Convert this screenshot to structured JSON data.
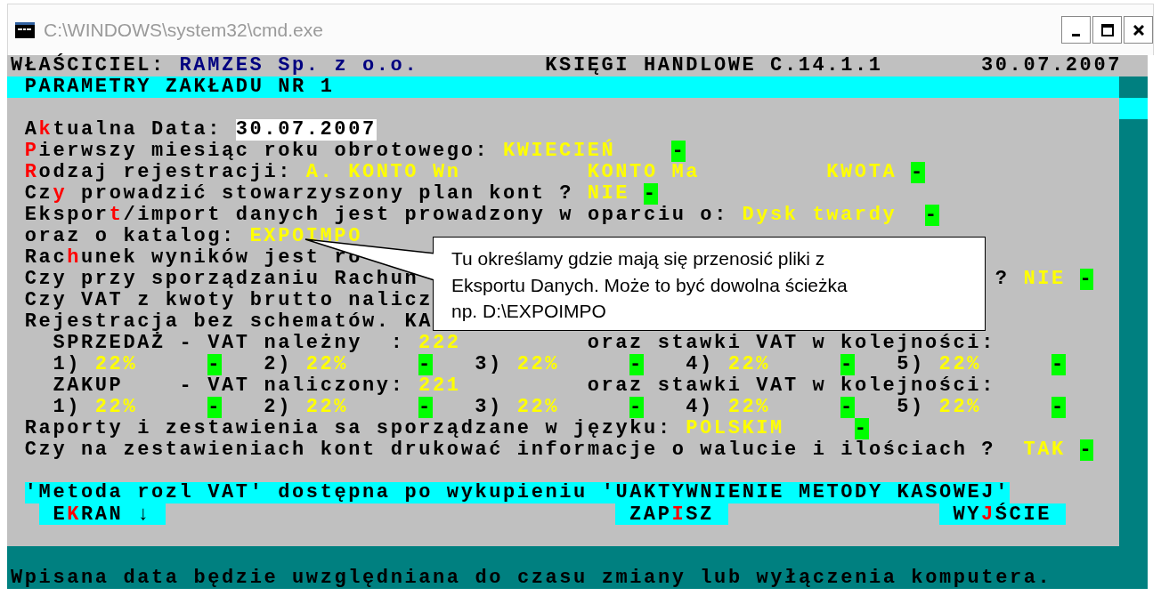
{
  "window": {
    "title": "C:\\WINDOWS\\system32\\cmd.exe"
  },
  "header": [
    {
      "kind": "label",
      "text": "WŁAŚCICIEL:"
    },
    {
      "kind": "owner",
      "text": "RAMZES Sp. z o.o."
    },
    {
      "kind": "label",
      "text": "KSIĘGI HANDLOWE C.14.1.1"
    },
    {
      "kind": "label",
      "text": "30.07.2007"
    }
  ],
  "section_title": "PARAMETRY ZAKŁADU NR 1",
  "form_rows": [
    {
      "segments": [
        {
          "kind": "label",
          "text": "A**k**tualna Data:"
        },
        {
          "kind": "input",
          "text": "30.07.2007"
        }
      ]
    },
    {
      "segments": [
        {
          "kind": "label",
          "text": "**P**ierwszy miesiąc roku obrotowego:"
        },
        {
          "kind": "value",
          "text": "KWIECIEŃ"
        },
        {
          "kind": "marker",
          "text": "-"
        }
      ]
    },
    {
      "segments": [
        {
          "kind": "label",
          "text": "**R**odzaj rejestracji:"
        },
        {
          "kind": "value",
          "text": "A. KONTO Wn"
        },
        {
          "kind": "value",
          "text": "KONTO Ma"
        },
        {
          "kind": "value",
          "text": "KWOTA"
        },
        {
          "kind": "marker",
          "text": "-"
        }
      ]
    },
    {
      "segments": [
        {
          "kind": "label",
          "text": "Cz**y** prowadzić stowarzyszony plan kont ?"
        },
        {
          "kind": "value",
          "text": "NIE"
        },
        {
          "kind": "marker",
          "text": "-"
        }
      ]
    },
    {
      "segments": [
        {
          "kind": "label",
          "text": "Ekspor**t**/import danych jest prowadzony w oparciu o:"
        },
        {
          "kind": "value",
          "text": "Dysk twardy"
        },
        {
          "kind": "marker",
          "text": "-"
        }
      ]
    },
    {
      "segments": [
        {
          "kind": "label",
          "text": "oraz o katalog:"
        },
        {
          "kind": "value",
          "text": "EXPOIMPO"
        }
      ]
    },
    {
      "segments": [
        {
          "kind": "label",
          "text": "Rac**h**unek wyników jest ro"
        }
      ]
    },
    {
      "segments": [
        {
          "kind": "label",
          "text": "Czy przy sporządzaniu Rachun"
        },
        {
          "kind": "label",
          "text": "?"
        },
        {
          "kind": "value",
          "text": "NIE"
        },
        {
          "kind": "marker",
          "text": "-"
        }
      ]
    },
    {
      "segments": [
        {
          "kind": "label",
          "text": "Czy VAT z kwoty brutto nalicz"
        }
      ]
    },
    {
      "segments": [
        {
          "kind": "label",
          "text": "Rejestracja bez schematów. KA"
        }
      ]
    },
    {
      "segments": [
        {
          "kind": "label",
          "text": "SPRZEDAŻ - VAT należny  :"
        },
        {
          "kind": "value",
          "text": "222"
        },
        {
          "kind": "label",
          "text": "oraz stawki VAT w kolejności:"
        }
      ]
    },
    {
      "segments": [
        {
          "kind": "label",
          "text": "1)"
        },
        {
          "kind": "value",
          "text": "22%"
        },
        {
          "kind": "marker",
          "text": "-"
        },
        {
          "kind": "label",
          "text": "2)"
        },
        {
          "kind": "value",
          "text": "22%"
        },
        {
          "kind": "marker",
          "text": "-"
        },
        {
          "kind": "label",
          "text": "3)"
        },
        {
          "kind": "value",
          "text": "22%"
        },
        {
          "kind": "marker",
          "text": "-"
        },
        {
          "kind": "label",
          "text": "4)"
        },
        {
          "kind": "value",
          "text": "22%"
        },
        {
          "kind": "marker",
          "text": "-"
        },
        {
          "kind": "label",
          "text": "5)"
        },
        {
          "kind": "value",
          "text": "22%"
        },
        {
          "kind": "marker",
          "text": "-"
        }
      ]
    },
    {
      "segments": [
        {
          "kind": "label",
          "text": "ZAKUP    - VAT naliczony:"
        },
        {
          "kind": "value",
          "text": "221"
        },
        {
          "kind": "label",
          "text": "oraz stawki VAT w kolejności:"
        }
      ]
    },
    {
      "segments": [
        {
          "kind": "label",
          "text": "1)"
        },
        {
          "kind": "value",
          "text": "22%"
        },
        {
          "kind": "marker",
          "text": "-"
        },
        {
          "kind": "label",
          "text": "2)"
        },
        {
          "kind": "value",
          "text": "22%"
        },
        {
          "kind": "marker",
          "text": "-"
        },
        {
          "kind": "label",
          "text": "3)"
        },
        {
          "kind": "value",
          "text": "22%"
        },
        {
          "kind": "marker",
          "text": "-"
        },
        {
          "kind": "label",
          "text": "4)"
        },
        {
          "kind": "value",
          "text": "22%"
        },
        {
          "kind": "marker",
          "text": "-"
        },
        {
          "kind": "label",
          "text": "5)"
        },
        {
          "kind": "value",
          "text": "22%"
        },
        {
          "kind": "marker",
          "text": "-"
        }
      ]
    },
    {
      "segments": [
        {
          "kind": "label",
          "text": "Raporty i zestawienia sa sporządzane w języku:"
        },
        {
          "kind": "value",
          "text": "POLSKIM"
        },
        {
          "kind": "marker",
          "text": "-"
        }
      ]
    },
    {
      "segments": [
        {
          "kind": "label",
          "text": "Czy na zestawieniach kont drukować informacje o walucie i ilościach ?"
        },
        {
          "kind": "value",
          "text": "TAK"
        },
        {
          "kind": "marker",
          "text": "-"
        }
      ]
    }
  ],
  "notice": "'Metoda rozl VAT' dostępna po wykupieniu 'UAKTYWNIENIE METODY KASOWEJ'",
  "buttons": [
    {
      "label": "E**K**RAN ↓"
    },
    {
      "label": "ZAP**I**SZ"
    },
    {
      "label": "WY**J**ŚCIE"
    }
  ],
  "status_bar": "Wpisana data będzie uwzględniana do czasu zmiany lub wyłączenia komputera.",
  "callout": "Tu określamy gdzie mają się przenosić pliki z\nEksportu Danych. Może to być dowolna ścieżka\nnp. D:\\EXPOIMPO"
}
